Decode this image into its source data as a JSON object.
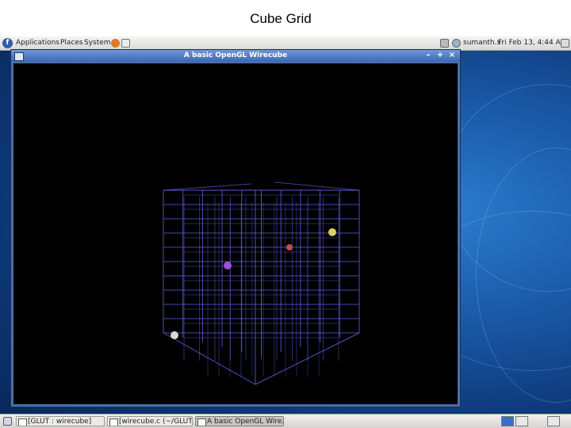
{
  "slide": {
    "title": "Cube Grid"
  },
  "top_panel": {
    "menus": [
      "Applications",
      "Places",
      "System"
    ],
    "user": "sumanth.s",
    "datetime": "Fri Feb 13, 4:44 AM"
  },
  "window": {
    "title": "A basic OpenGL Wirecube",
    "buttons": {
      "minimize": "–",
      "maximize": "+",
      "close": "×"
    }
  },
  "scene": {
    "wire_color": "#5a5ad8",
    "spheres": [
      {
        "name": "yellow-sphere",
        "color": "#d8d060"
      },
      {
        "name": "red-sphere",
        "color": "#c0504a"
      },
      {
        "name": "purple-sphere",
        "color": "#a050d0"
      },
      {
        "name": "white-sphere",
        "color": "#d8d8d8"
      }
    ]
  },
  "taskbar": {
    "tasks": [
      {
        "label": "[GLUT : wirecube]",
        "active": false
      },
      {
        "label": "[wirecube.c (~/GLUT/)...",
        "active": false
      },
      {
        "label": "A basic OpenGL Wire...",
        "active": true
      }
    ]
  }
}
